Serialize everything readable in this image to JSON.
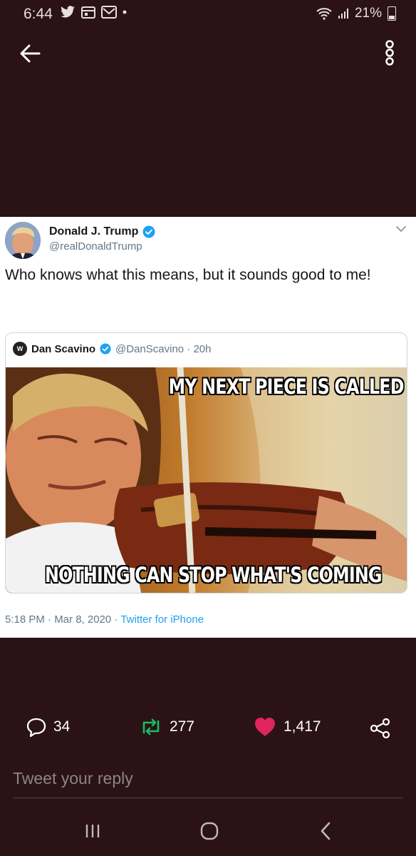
{
  "status": {
    "time": "6:44",
    "battery_text": "21%"
  },
  "tweet": {
    "author_name": "Donald J. Trump",
    "author_handle": "@realDonaldTrump",
    "text": "Who knows what this means, but it sounds good to me!",
    "timestamp": "5:18 PM · Mar 8, 2020 · ",
    "source": "Twitter for iPhone"
  },
  "quote": {
    "avatar_text": "W",
    "author_name": "Dan Scavino",
    "author_meta": "@DanScavino · 20h",
    "meme_top": "MY NEXT PIECE IS CALLED",
    "meme_bottom": "NOTHING CAN STOP WHAT'S COMING"
  },
  "actions": {
    "reply_count": "34",
    "retweet_count": "277",
    "like_count": "1,417"
  },
  "reply": {
    "placeholder": "Tweet your reply"
  },
  "colors": {
    "background": "#2a1216",
    "retweet": "#17bf63",
    "like": "#e0245e",
    "verified": "#1da1f2"
  }
}
